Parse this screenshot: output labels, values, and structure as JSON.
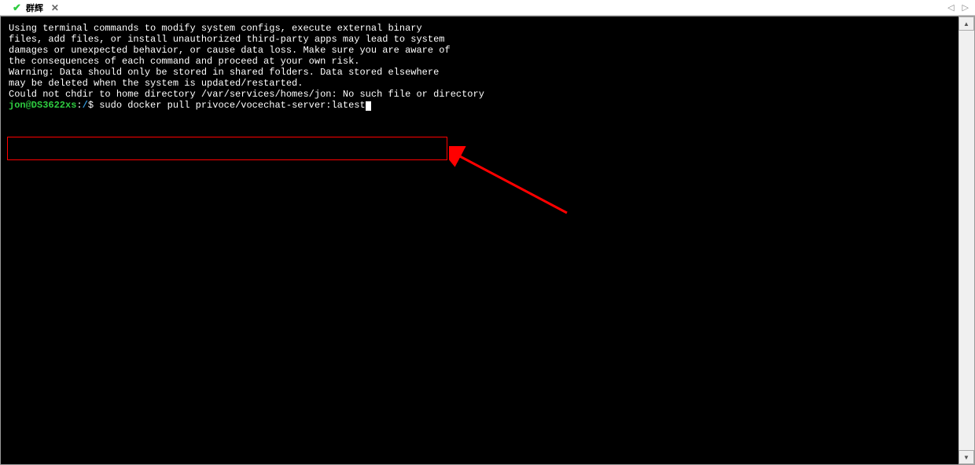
{
  "tab": {
    "title": "群辉",
    "check_icon": "✔",
    "close": "✕"
  },
  "nav": {
    "prev": "◁",
    "next": "▷"
  },
  "scrollbar": {
    "up": "▲",
    "down": "▼"
  },
  "terminal": {
    "lines": [
      "",
      "Using terminal commands to modify system configs, execute external binary",
      "files, add files, or install unauthorized third-party apps may lead to system",
      "damages or unexpected behavior, or cause data loss. Make sure you are aware of",
      "the consequences of each command and proceed at your own risk.",
      "",
      "Warning: Data should only be stored in shared folders. Data stored elsewhere",
      "may be deleted when the system is updated/restarted.",
      "",
      "Could not chdir to home directory /var/services/homes/jon: No such file or directory"
    ],
    "prompt": {
      "user_host": "jon@DS3622xs",
      "sep1": ":",
      "path": "/",
      "sep2": "$ ",
      "command": "sudo docker pull privoce/vocechat-server:latest"
    }
  }
}
